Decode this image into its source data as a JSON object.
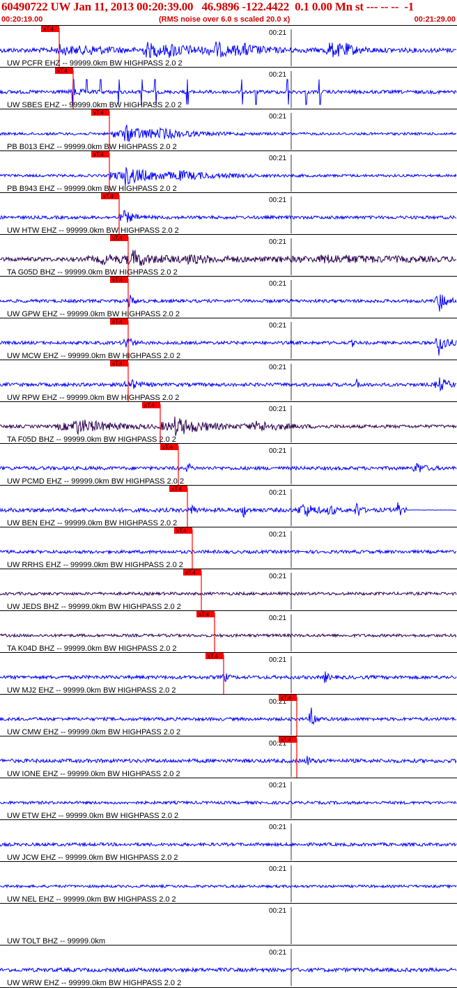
{
  "header": {
    "title": "60490722 UW Jan 11, 2013 00:20:39.00   46.9896 -122.4422  0.1 0.00 Mn st --- -- --  -1",
    "start_time": "00:20:19.00",
    "note": "(RMS noise over 6.0 s scaled 20.0 x)",
    "end_time": "00:21:29.00"
  },
  "time_tick_label": "00:21",
  "pick_label": "xT.4",
  "colors": {
    "blue": "#0000ff",
    "dark": "#2a0050",
    "pick": "#ff0000",
    "text": "#000000",
    "header_text": "#d40000"
  },
  "traces": [
    {
      "label": "UW PCFR EHZ -- 99999.0km BW  HIGHPASS  2.0  2",
      "color": "blue",
      "pick": 0.13,
      "amp": 0.8,
      "bursts": [
        [
          0.13,
          0.04,
          1.4
        ],
        [
          0.19,
          0.05,
          1.1
        ],
        [
          0.32,
          0.03,
          2.4
        ],
        [
          0.37,
          0.06,
          1.6
        ],
        [
          0.47,
          0.03,
          2.3
        ],
        [
          0.53,
          0.04,
          1.6
        ],
        [
          0.72,
          0.03,
          2.4
        ],
        [
          0.75,
          0.02,
          1.5
        ]
      ]
    },
    {
      "label": "UW SBES EHZ -- 99999.0km BW  HIGHPASS  2.0  2",
      "color": "blue",
      "pick": 0.16,
      "amp": 0.6,
      "spikes": [
        0.16,
        0.19,
        0.22,
        0.26,
        0.31,
        0.34,
        0.41,
        0.53,
        0.56,
        0.63,
        0.67,
        0.7
      ],
      "bursts": [
        [
          0.16,
          0.02,
          1.2
        ]
      ]
    },
    {
      "label": "PB B013 EHZ -- 99999.0km BW  HIGHPASS  2.0  2",
      "color": "blue",
      "pick": 0.24,
      "amp": 0.45,
      "bursts": [
        [
          0.27,
          0.05,
          3.0
        ],
        [
          0.35,
          0.06,
          1.2
        ]
      ]
    },
    {
      "label": "PB B943 EHZ -- 99999.0km BW  HIGHPASS  2.0  2",
      "color": "blue",
      "pick": 0.24,
      "amp": 0.45,
      "bursts": [
        [
          0.27,
          0.06,
          3.2
        ],
        [
          0.38,
          0.08,
          1.2
        ]
      ]
    },
    {
      "label": "UW HTW EHZ -- 99999.0km BW  HIGHPASS  2.0  2",
      "color": "blue",
      "pick": 0.26,
      "amp": 0.55,
      "bursts": [
        [
          0.27,
          0.02,
          2.2
        ]
      ]
    },
    {
      "label": "TA G05D BHZ -- 99999.0km BW  HIGHPASS  2.0  2",
      "color": "dark",
      "pick": 0.28,
      "amp": 0.7,
      "bursts": [
        [
          0.22,
          0.06,
          1.4
        ],
        [
          0.29,
          0.03,
          2.6
        ],
        [
          0.4,
          0.1,
          1.2
        ],
        [
          0.7,
          0.2,
          1.1
        ]
      ]
    },
    {
      "label": "UW GPW EHZ -- 99999.0km BW  HIGHPASS  2.0  2",
      "color": "blue",
      "pick": 0.28,
      "amp": 0.55,
      "bursts": [
        [
          0.28,
          0.01,
          2.6
        ],
        [
          0.96,
          0.015,
          4.0
        ]
      ]
    },
    {
      "label": "UW MCW EHZ -- 99999.0km BW  HIGHPASS  2.0  2",
      "color": "blue",
      "pick": 0.28,
      "amp": 0.55,
      "bursts": [
        [
          0.275,
          0.01,
          3.0
        ],
        [
          0.77,
          0.003,
          1.6
        ],
        [
          0.96,
          0.015,
          4.5
        ]
      ]
    },
    {
      "label": "UW RPW EHZ -- 99999.0km BW  HIGHPASS  2.0  2",
      "color": "blue",
      "pick": 0.28,
      "amp": 0.6,
      "bursts": [
        [
          0.28,
          0.015,
          2.4
        ],
        [
          0.78,
          0.005,
          1.5
        ],
        [
          0.96,
          0.02,
          2.2
        ]
      ]
    },
    {
      "label": "TA F05D BHZ -- 99999.0km BW  HIGHPASS  2.0  2",
      "color": "dark",
      "pick": 0.35,
      "amp": 0.55,
      "bursts": [
        [
          0.16,
          0.07,
          2.6
        ],
        [
          0.38,
          0.06,
          3.0
        ],
        [
          0.56,
          0.05,
          1.6
        ]
      ]
    },
    {
      "label": "UW PCMD EHZ -- 99999.0km BW  HIGHPASS  2.0  2",
      "color": "blue",
      "pick": 0.39,
      "amp": 0.6,
      "bursts": [
        [
          0.41,
          0.005,
          2.4
        ],
        [
          0.91,
          0.015,
          2.0
        ]
      ]
    },
    {
      "label": "UW BEN EHZ -- 99999.0km BW  HIGHPASS  2.0  2",
      "color": "blue",
      "pick": 0.41,
      "amp": 0.7,
      "bursts": [
        [
          0.42,
          0.005,
          2.4
        ],
        [
          0.53,
          0.006,
          3.5
        ],
        [
          0.66,
          0.02,
          3.0
        ],
        [
          0.72,
          0.006,
          3.6
        ],
        [
          0.78,
          0.006,
          3.6
        ],
        [
          0.87,
          0.006,
          3.6
        ]
      ],
      "flat_after": 0.89
    },
    {
      "label": "UW RRHS EHZ -- 99999.0km BW  HIGHPASS  2.0  2",
      "color": "blue",
      "pick": 0.42,
      "amp": 0.55,
      "bursts": []
    },
    {
      "label": "UW JEDS BHZ -- 99999.0km BW  HIGHPASS  2.0  2",
      "color": "dark",
      "pick": 0.44,
      "amp": 0.5,
      "bursts": []
    },
    {
      "label": "TA K04D BHZ -- 99999.0km BW  HIGHPASS  2.0  2",
      "color": "dark",
      "pick": 0.47,
      "amp": 0.5,
      "bursts": []
    },
    {
      "label": "UW MJ2 EHZ -- 99999.0km BW  HIGHPASS  2.0  2",
      "color": "blue",
      "pick": 0.49,
      "amp": 0.6,
      "bursts": [
        [
          0.49,
          0.005,
          2.4
        ],
        [
          0.71,
          0.007,
          2.0
        ]
      ]
    },
    {
      "label": "UW CMW EHZ -- 99999.0km BW  HIGHPASS  2.0  2",
      "color": "blue",
      "pick": 0.65,
      "amp": 0.55,
      "bursts": [
        [
          0.68,
          0.008,
          4.5
        ]
      ]
    },
    {
      "label": "UW IONE EHZ -- 99999.0km BW  HIGHPASS  2.0  2",
      "color": "blue",
      "pick": 0.65,
      "amp": 0.65,
      "bursts": [
        [
          0.67,
          0.006,
          2.2
        ]
      ]
    },
    {
      "label": "UW ETW EHZ -- 99999.0km BW  HIGHPASS  2.0  2",
      "color": "blue",
      "pick": null,
      "amp": 0.5,
      "bursts": []
    },
    {
      "label": "UW JCW EHZ -- 99999.0km BW  HIGHPASS  2.0  2",
      "color": "blue",
      "pick": null,
      "amp": 0.55,
      "bursts": []
    },
    {
      "label": "UW NEL EHZ -- 99999.0km BW  HIGHPASS  2.0  2",
      "color": "blue",
      "pick": null,
      "amp": 0.45,
      "bursts": []
    },
    {
      "label": "UW TOLT BHZ -- 99999.0km",
      "color": "blue",
      "pick": null,
      "amp": 0,
      "bursts": []
    },
    {
      "label": "UW WRW EHZ -- 99999.0km BW  HIGHPASS  2.0  2",
      "color": "blue",
      "pick": null,
      "amp": 0.65,
      "bursts": []
    }
  ]
}
